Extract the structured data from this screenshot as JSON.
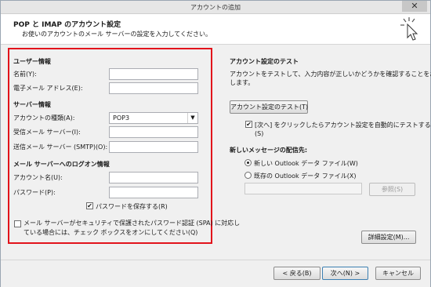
{
  "window": {
    "title": "アカウントの追加",
    "close_glyph": "✕"
  },
  "header": {
    "title": "POP と IMAP のアカウント設定",
    "subtitle": "お使いのアカウントのメール サーバーの設定を入力してください。"
  },
  "user_info": {
    "section": "ユーザー情報",
    "name_label": "名前(Y):",
    "name_value": "",
    "email_label": "電子メール アドレス(E):",
    "email_value": ""
  },
  "server_info": {
    "section": "サーバー情報",
    "account_type_label": "アカウントの種類(A):",
    "account_type_value": "POP3",
    "incoming_label": "受信メール サーバー(I):",
    "incoming_value": "",
    "outgoing_label": "送信メール サーバー (SMTP)(O):",
    "outgoing_value": ""
  },
  "logon_info": {
    "section": "メール サーバーへのログオン情報",
    "account_name_label": "アカウント名(U):",
    "account_name_value": "",
    "password_label": "パスワード(P):",
    "password_value": "",
    "save_password_label": "パスワードを保存する(R)",
    "save_password_checked": true,
    "spa_label_line1": "メール サーバーがセキュリティで保護されたパスワード認証 (SPA) に対応し",
    "spa_label_line2": "ている場合には、チェック ボックスをオンにしてください(Q)",
    "spa_checked": false
  },
  "test": {
    "section": "アカウント設定のテスト",
    "desc_line1": "アカウントをテストして、入力内容が正しいかどうかを確認することをお勧め",
    "desc_line2": "します。",
    "test_button": "アカウント設定のテスト(T)",
    "auto_test_line1": "[次へ] をクリックしたらアカウント設定を自動的にテストする",
    "auto_test_line2": "(S)",
    "auto_test_checked": true
  },
  "delivery": {
    "section": "新しいメッセージの配信先:",
    "new_file_label": "新しい Outlook データ ファイル(W)",
    "existing_file_label": "既存の Outlook データ ファイル(X)",
    "selected": "new",
    "existing_path": "",
    "browse_button": "参照(S)"
  },
  "more_settings_button": "詳細設定(M)...",
  "footer": {
    "back": "< 戻る(B)",
    "next": "次へ(N) >",
    "cancel": "キャンセル"
  },
  "check_glyph": "✔"
}
